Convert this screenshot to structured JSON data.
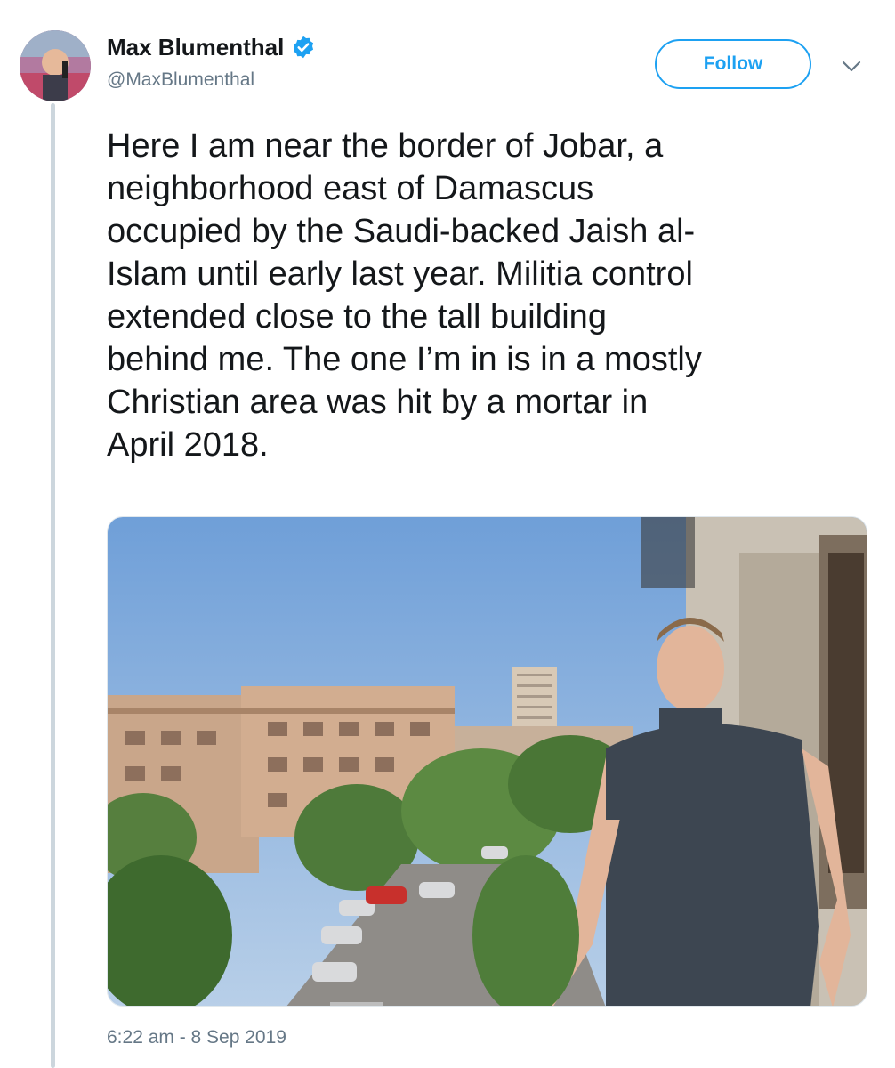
{
  "author": {
    "display_name": "Max Blumenthal",
    "handle": "@MaxBlumenthal",
    "verified_icon": "verified-badge-icon",
    "avatar_icon": "avatar"
  },
  "actions": {
    "follow_label": "Follow",
    "more_icon": "chevron-down-icon"
  },
  "tweet": {
    "text": "Here I am near the border of Jobar, a\nneighborhood east of Damascus\noccupied by the Saudi-backed Jaish al-\nIslam until early last year. Militia control\nextended close to the tall building\nbehind me. The one I’m in is in a mostly\nChristian area was hit by a mortar in\nApril 2018.",
    "timestamp": "6:22 am - 8 Sep 2019"
  },
  "colors": {
    "accent": "#1da1f2",
    "secondary_text": "#657786",
    "primary_text": "#14171a",
    "thread_line": "#ccd6dd"
  }
}
